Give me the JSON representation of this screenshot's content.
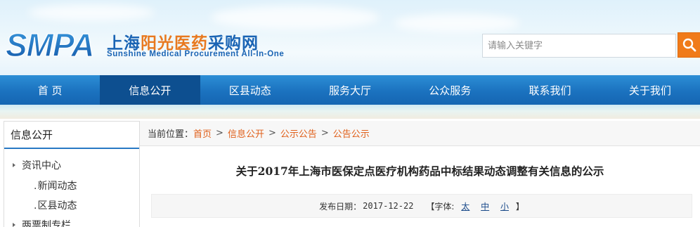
{
  "header": {
    "logo_abbr": "SMPA",
    "logo_cn_part1": "上海",
    "logo_cn_part2": "阳光医药",
    "logo_cn_part3": "采购网",
    "logo_en": "Sunshine Medical Procurement All-In-One",
    "search": {
      "placeholder": "请输入关键字"
    },
    "colors": {
      "brand_blue": "#1a64b4",
      "accent_orange": "#e8791f",
      "search_button": "#f07b1a"
    },
    "search_icon": "search-icon"
  },
  "nav": {
    "items": [
      {
        "label": "首 页",
        "active": false
      },
      {
        "label": "信息公开",
        "active": true
      },
      {
        "label": "区县动态",
        "active": false
      },
      {
        "label": "服务大厅",
        "active": false
      },
      {
        "label": "公众服务",
        "active": false
      },
      {
        "label": "联系我们",
        "active": false
      },
      {
        "label": "关于我们",
        "active": false
      }
    ]
  },
  "sidebar": {
    "title": "信息公开",
    "items": [
      {
        "label": "资讯中心",
        "icon": "triangle-right-icon"
      },
      {
        "label": "新闻动态",
        "prefix": "."
      },
      {
        "label": "区县动态",
        "prefix": "."
      },
      {
        "label": "两票制专栏",
        "icon": "triangle-right-icon"
      }
    ]
  },
  "breadcrumb": {
    "label": "当前位置：",
    "items": [
      "首页",
      "信息公开",
      "公示公告",
      "公告公示"
    ],
    "separator": ">"
  },
  "article": {
    "title": "关于2017年上海市医保定点医疗机构药品中标结果动态调整有关信息的公示",
    "date_label": "发布日期：",
    "date_value": "2017-12-22",
    "font_open": "【字体:",
    "font_close": "】",
    "font_options": [
      "太",
      "中",
      "小"
    ]
  }
}
